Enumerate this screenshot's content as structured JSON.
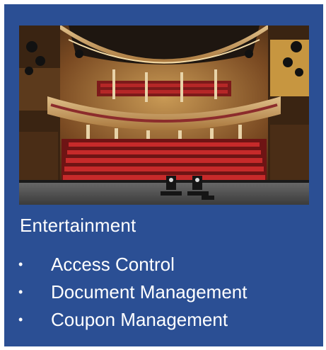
{
  "card": {
    "background_color": "#2b4f94",
    "image_subject": "theatre-auditorium-photo",
    "heading": "Entertainment",
    "features": [
      {
        "bullet": "•",
        "label": "Access Control"
      },
      {
        "bullet": "•",
        "label": "Document Management"
      },
      {
        "bullet": "•",
        "label": "Coupon Management"
      }
    ]
  }
}
